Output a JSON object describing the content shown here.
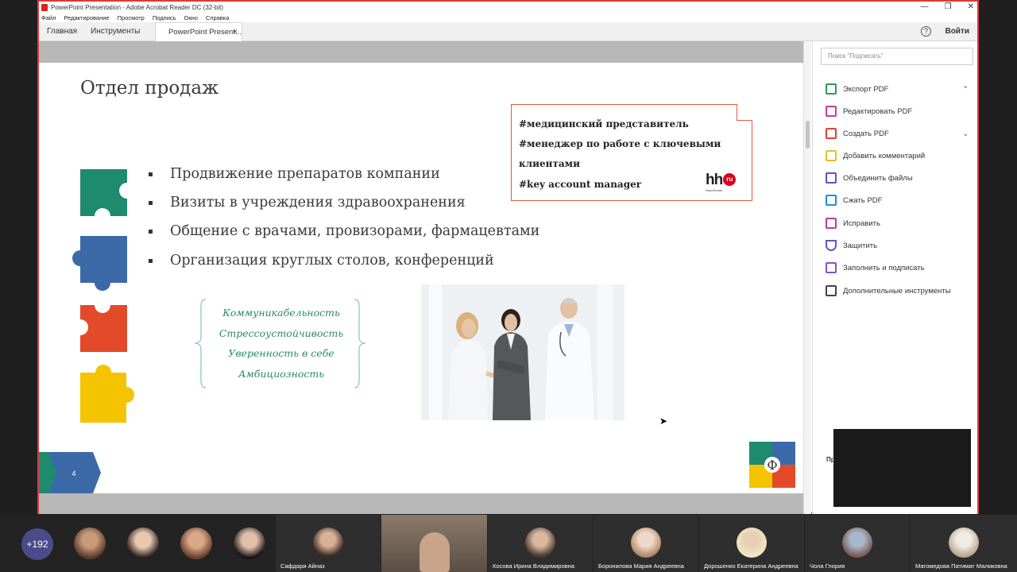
{
  "window": {
    "title": "PowerPoint Presentation - Adobe Acrobat Reader DC (32-bit)",
    "controls": [
      "—",
      "❐",
      "✕"
    ]
  },
  "menu": [
    "Файл",
    "Редактирование",
    "Просмотр",
    "Подпись",
    "Окно",
    "Справка"
  ],
  "tabs": {
    "home": "Главная",
    "tools": "Инструменты",
    "doc": "PowerPoint Present...",
    "close": "×",
    "help": "?",
    "login": "Войти"
  },
  "slide": {
    "title": "Отдел продаж",
    "hh_tags": [
      "#медицинский представитель",
      "#менеджер по работе с ключевыми",
      "клиентами",
      "#key account manager"
    ],
    "hh_logo": {
      "main": "hh",
      "ru": "ru",
      "sub": "HeadHunter"
    },
    "bullets": [
      "Продвижение препаратов компании",
      "Визиты в учреждения здравоохранения",
      "Общение с врачами, провизорами, фармацевтами",
      "Организация круглых столов, конференций"
    ],
    "skills": [
      "Коммуникабельность",
      "Стрессоустойчивость",
      "Уверенность в себе",
      "Амбициозность"
    ],
    "page_number": "4",
    "logo_letter": "Ф"
  },
  "right_panel": {
    "search_placeholder": "Поиск \"Подписать\"",
    "tools": [
      {
        "label": "Экспорт PDF",
        "icon": "export-pdf-icon",
        "color": "#2a9d5c"
      },
      {
        "label": "Редактировать PDF",
        "icon": "edit-pdf-icon",
        "color": "#d9388a"
      },
      {
        "label": "Создать PDF",
        "icon": "create-pdf-icon",
        "color": "#e0423a"
      },
      {
        "label": "Добавить комментарий",
        "icon": "comment-icon",
        "color": "#e8c020"
      },
      {
        "label": "Объединить файлы",
        "icon": "combine-icon",
        "color": "#6a4bc4"
      },
      {
        "label": "Сжать PDF",
        "icon": "compress-icon",
        "color": "#1e8fd8"
      },
      {
        "label": "Исправить",
        "icon": "redact-icon",
        "color": "#c43aa0"
      },
      {
        "label": "Защитить",
        "icon": "protect-icon",
        "color": "#5a5ad0"
      },
      {
        "label": "Заполнить и подписать",
        "icon": "fill-sign-icon",
        "color": "#8a50c8"
      },
      {
        "label": "Дополнительные инструменты",
        "icon": "more-tools-icon",
        "color": "#444444"
      }
    ],
    "partial_label": "Пр"
  },
  "participants": {
    "count": "+192",
    "tiles": [
      {
        "name": "Сафдари Айназ"
      },
      {
        "name": ""
      },
      {
        "name": "Косова Ирина Владимировна"
      },
      {
        "name": "Боронилова Мария Андреевна"
      },
      {
        "name": "Дорошенко Екатерина Андреевна"
      },
      {
        "name": "Чола Глория"
      },
      {
        "name": "Магомедова Патимат Маликовна"
      }
    ]
  }
}
